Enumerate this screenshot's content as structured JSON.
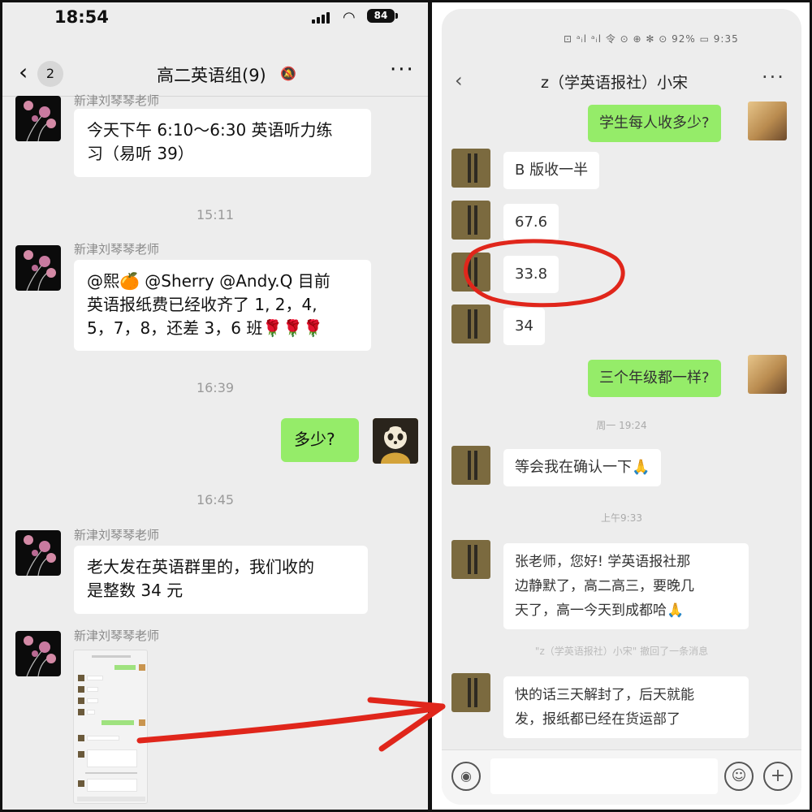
{
  "left": {
    "status": {
      "time": "18:54",
      "battery": "84"
    },
    "nav": {
      "back_badge": "2",
      "title": "高二英语组(9)"
    },
    "messages": {
      "m1_sender": "新津刘琴琴老师",
      "m1_line1": "今天下午 6:10～6:30 英语听力练",
      "m1_line2": "习（易听 39）",
      "t1": "15:11",
      "m2_sender": "新津刘琴琴老师",
      "m2_line1": "@熙🍊 @Sherry @Andy.Q 目前",
      "m2_line2": "英语报纸费已经收齐了 1, 2，4,",
      "m2_line3": "5，7，8，还差 3，6 班🌹🌹🌹",
      "t2": "16:39",
      "m3_text": "多少?",
      "t3": "16:45",
      "m4_sender": "新津刘琴琴老师",
      "m4_line1": "老大发在英语群里的，我们收的",
      "m4_line2": "是整数 34 元",
      "m5_sender": "新津刘琴琴老师"
    }
  },
  "right": {
    "status": "⊡ ᵃᵢl ᵃᵢl 令   ⊙ ⊕ ✻ ⊙ 92% ▭ 9:35",
    "title": "z（学英语报社）小宋",
    "messages": {
      "r1": "学生每人收多少?",
      "r2": "B 版收一半",
      "r3": "67.6",
      "r4": "33.8",
      "r5": "34",
      "r6": "三个年级都一样?",
      "t1": "周一 19:24",
      "r7": "等会我在确认一下🙏",
      "t2": "上午9:33",
      "r8_line1": "张老师，您好! 学英语报社那",
      "r8_line2": "边静默了，高二高三，要晚几",
      "r8_line3": "天了，高一今天到成都哈🙏",
      "recall": "\"z（学英语报社）小宋\" 撤回了一条消息",
      "r9_line1": "快的话三天解封了，后天就能",
      "r9_line2": "发，报纸都已经在货运部了"
    }
  },
  "annotations": {
    "circle_color": "#e0261b",
    "arrow_color": "#e0261b"
  }
}
